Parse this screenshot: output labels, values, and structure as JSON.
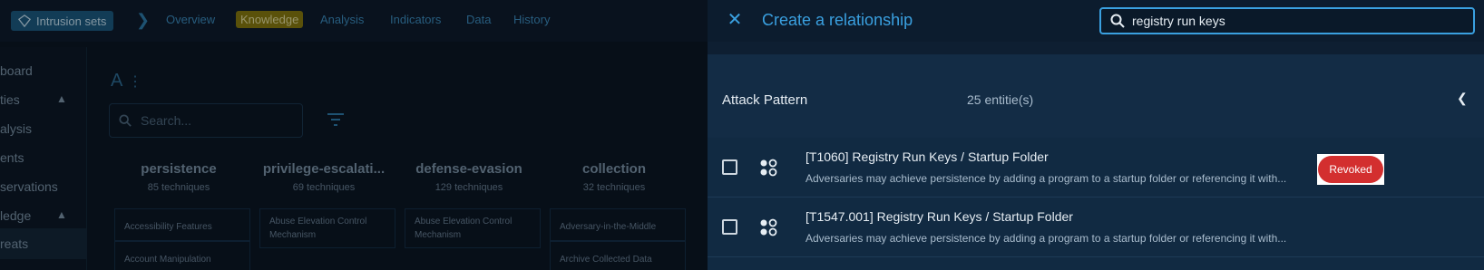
{
  "app": {
    "entity_chip": "Intrusion sets",
    "tabs": [
      {
        "label": "Overview"
      },
      {
        "label": "Knowledge"
      },
      {
        "label": "Analysis"
      },
      {
        "label": "Indicators"
      },
      {
        "label": "Data"
      },
      {
        "label": "History"
      }
    ],
    "sidebar": [
      {
        "label": "board"
      },
      {
        "label": "ties"
      },
      {
        "label": "alysis"
      },
      {
        "label": "ents"
      },
      {
        "label": "servations"
      },
      {
        "label": "ledge"
      },
      {
        "label": "reats"
      }
    ],
    "main": {
      "title": "A",
      "search_placeholder": "Search...",
      "columns": [
        {
          "title": "persistence",
          "count": "85 techniques",
          "cells": [
            "Accessibility Features",
            "Account Manipulation"
          ]
        },
        {
          "title": "privilege-escalati...",
          "count": "69 techniques",
          "cells": [
            "Abuse Elevation Control Mechanism"
          ]
        },
        {
          "title": "defense-evasion",
          "count": "129 techniques",
          "cells": [
            "Abuse Elevation Control Mechanism"
          ]
        },
        {
          "title": "collection",
          "count": "32 techniques",
          "cells": [
            "Adversary-in-the-Middle",
            "Archive Collected Data"
          ]
        }
      ]
    }
  },
  "drawer": {
    "title": "Create a relationship",
    "search_value": "registry run keys",
    "group": {
      "name": "Attack Pattern",
      "count": "25 entitie(s)"
    },
    "rows": [
      {
        "title": "[T1060] Registry Run Keys / Startup Folder",
        "description": "Adversaries may achieve persistence by adding a program to a startup folder or referencing it with...",
        "badge": "Revoked"
      },
      {
        "title": "[T1547.001] Registry Run Keys / Startup Folder",
        "description": "Adversaries may achieve persistence by adding a program to a startup folder or referencing it with..."
      }
    ]
  },
  "colors": {
    "accent": "#3aa0e0",
    "revoked": "#d32f2f",
    "knowledge_tab": "#8a7d10"
  }
}
